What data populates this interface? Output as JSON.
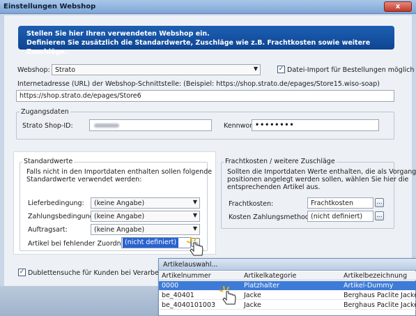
{
  "window": {
    "title": "Einstellungen Webshop",
    "close_label": "x"
  },
  "banner": {
    "line1": "Stellen Sie hier Ihren verwendeten Webshop ein.",
    "line2": "Definieren Sie zusätzlich die Standardwerte, Zuschläge wie z.B. Frachtkosten sowie weitere Zuschläge."
  },
  "webshop": {
    "label": "Webshop:",
    "value": "Strato",
    "import_checkbox_label": "Datei-Import für Bestellungen möglich",
    "import_checked": true
  },
  "url": {
    "label": "Internetadresse (URL) der Webshop-Schnittstelle: (Beispiel: https://shop.strato.de/epages/Store15.wiso-soap)",
    "value": "https://shop.strato.de/epages/Store6"
  },
  "zugangsdaten": {
    "title": "Zugangsdaten",
    "shop_id_label": "Strato Shop-ID:",
    "password_label": "Kennwort:",
    "password_value": "••••••••"
  },
  "standardwerte": {
    "title": "Standardwerte",
    "description_line1": "Falls nicht in den Importdaten enthalten sollen folgende",
    "description_line2": "Standardwerte verwendet werden:",
    "lieferbedingung_label": "Lieferbedingung:",
    "lieferbedingung_value": "(keine Angabe)",
    "zahlungsbedingung_label": "Zahlungsbedingung:",
    "zahlungsbedingung_value": "(keine Angabe)",
    "auftragsart_label": "Auftragsart:",
    "auftragsart_value": "(keine Angabe)",
    "artikel_label": "Artikel bei fehlender Zuordnung:",
    "artikel_value": "(nicht definiert)"
  },
  "fracht": {
    "title": "Frachtkosten / weitere Zuschläge",
    "description_line1": "Sollten die Importdaten Werte enthalten, die als Vorgangs-",
    "description_line2": "positionen angelegt werden sollen, wählen Sie hier die",
    "description_line3": "entsprechenden Artikel aus.",
    "frachtkosten_label": "Frachtkosten:",
    "frachtkosten_value": "Frachtkosten",
    "zahlungsmethode_label": "Kosten Zahlungsmethode:",
    "zahlungsmethode_value": "(nicht definiert)"
  },
  "dubletten": {
    "label": "Dublettensuche für Kunden bei Verarbeitung im",
    "checked": true
  },
  "popup": {
    "title": "Artikelauswahl...",
    "columns": [
      "Artikelnummer",
      "Artikelkategorie",
      "Artikelbezeichnung"
    ],
    "rows": [
      [
        "0000",
        "Platzhalter",
        "Artikel-Dummy"
      ],
      [
        "be_40401",
        "Jacke",
        "Berghaus Paclite Jacket - I"
      ],
      [
        "be_4040101003",
        "Jacke",
        "Berghaus Paclite Jacket - I"
      ]
    ]
  },
  "icons": {
    "close": "close-icon",
    "dropdown": "chevron-down-icon",
    "cursor": "hand-pointer-icon",
    "ellipsis": "ellipsis-icon"
  }
}
